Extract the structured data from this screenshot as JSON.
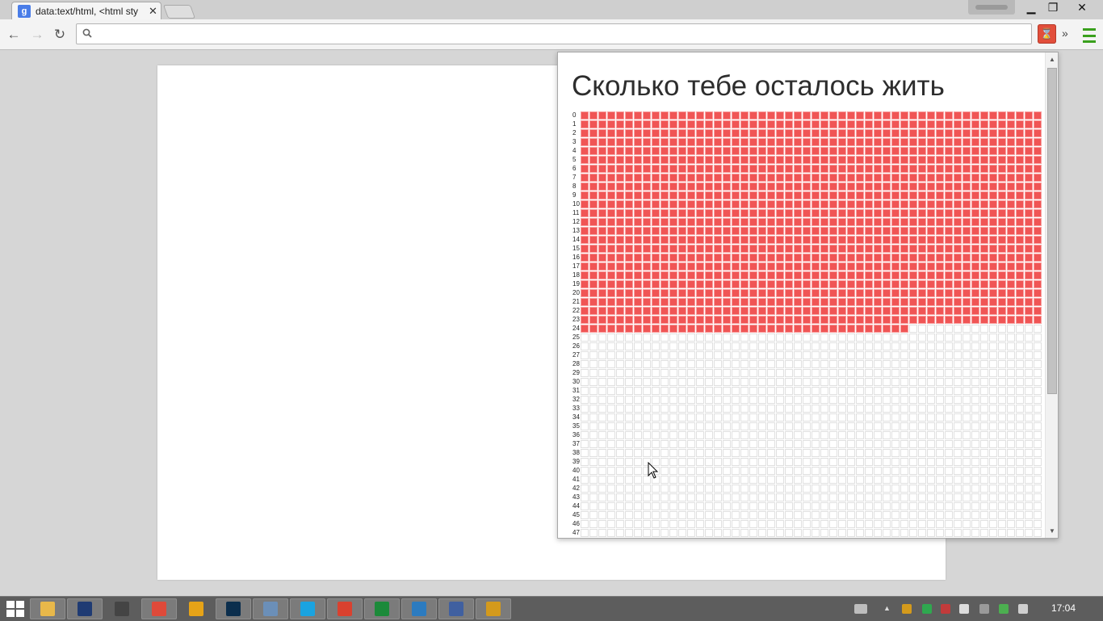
{
  "browser": {
    "tab": {
      "title": "data:text/html, <html  sty",
      "favicon_letter": "g"
    },
    "window_controls": {
      "minimize": "▁",
      "maximize": "❐",
      "close": "✕"
    },
    "toolbar": {
      "back": "←",
      "forward": "→",
      "reload": "↻",
      "search_icon": "🔍",
      "extension_icon": "⌛",
      "overflow": "»"
    },
    "omnibox": {
      "value": ""
    }
  },
  "popup": {
    "title": "Сколько тебе осталось жить",
    "grid": {
      "row_labels": [
        "0",
        "1",
        "2",
        "3",
        "4",
        "5",
        "6",
        "7",
        "8",
        "9",
        "10",
        "11",
        "12",
        "13",
        "14",
        "15",
        "16",
        "17",
        "18",
        "19",
        "20",
        "21",
        "22",
        "23",
        "24",
        "25",
        "26",
        "27",
        "28",
        "29",
        "30",
        "31",
        "32",
        "33",
        "34",
        "35",
        "36",
        "37",
        "38",
        "39",
        "40",
        "41",
        "42",
        "43",
        "44",
        "45",
        "46",
        "47"
      ],
      "weeks_per_row": 52,
      "full_lived_rows": 24,
      "weeks_lived_in_current_row": 37,
      "lived_color": "#f05555",
      "empty_color": "#ffffff"
    }
  },
  "taskbar": {
    "icons": [
      {
        "name": "file-explorer",
        "color": "#e8b84a",
        "active": true
      },
      {
        "name": "cmd",
        "color": "#1f3b73",
        "active": true
      },
      {
        "name": "window-app",
        "color": "#444444",
        "active": false
      },
      {
        "name": "chrome",
        "color": "#de4a3a",
        "active": true
      },
      {
        "name": "canary",
        "color": "#e6a317",
        "active": false
      },
      {
        "name": "photoshop",
        "color": "#0b2e4d",
        "active": true
      },
      {
        "name": "image-viewer",
        "color": "#6b8fb8",
        "active": true
      },
      {
        "name": "skype",
        "color": "#1aa3e0",
        "active": true
      },
      {
        "name": "target-app",
        "color": "#d9412f",
        "active": true
      },
      {
        "name": "calculator",
        "color": "#1c8a3a",
        "active": true
      },
      {
        "name": "webstorm",
        "color": "#2c7bbf",
        "active": true
      },
      {
        "name": "contacts-app",
        "color": "#4060a0",
        "active": true
      },
      {
        "name": "shield-app",
        "color": "#d49a1c",
        "active": true
      }
    ],
    "clock": "17:04"
  }
}
